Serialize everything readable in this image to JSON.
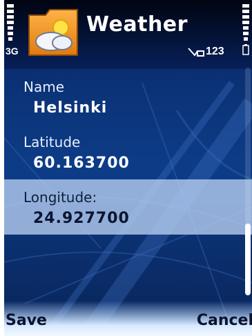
{
  "status": {
    "network": "3G",
    "indicator_text": "123"
  },
  "app": {
    "title": "Weather",
    "icon": "folder-weather-icon"
  },
  "form": {
    "fields": [
      {
        "label": "Name",
        "value": "Helsinki"
      },
      {
        "label": "Latitude",
        "value": "60.163700"
      },
      {
        "label": "Longitude:",
        "value": "24.927700"
      }
    ],
    "selected_index": 2
  },
  "softkeys": {
    "left": "Save",
    "right": "Cancel"
  },
  "colors": {
    "background": "#0d3c87",
    "highlight": "#b4cdf0",
    "softkey_bar": "#d6e9ff"
  }
}
